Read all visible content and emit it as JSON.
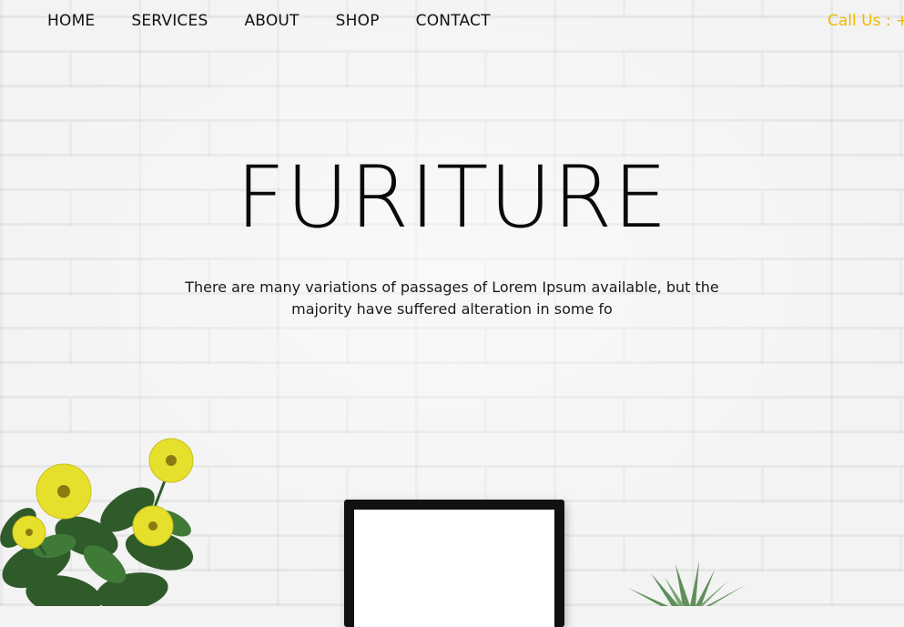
{
  "nav": {
    "items": [
      {
        "label": "HOME"
      },
      {
        "label": "SERVICES"
      },
      {
        "label": "ABOUT"
      },
      {
        "label": "SHOP"
      },
      {
        "label": "CONTACT"
      }
    ],
    "call_label": "Call Us : +"
  },
  "hero": {
    "title": "FURITURE",
    "description": "There are many variations of passages of Lorem Ipsum available, but the majority have suffered alteration in some fo"
  },
  "colors": {
    "accent": "#f0b800",
    "text": "#111111",
    "wall": "#f2f2f2"
  },
  "decor": {
    "left": "flowering-plant-icon",
    "center": "picture-frame",
    "right": "succulent-icon"
  }
}
